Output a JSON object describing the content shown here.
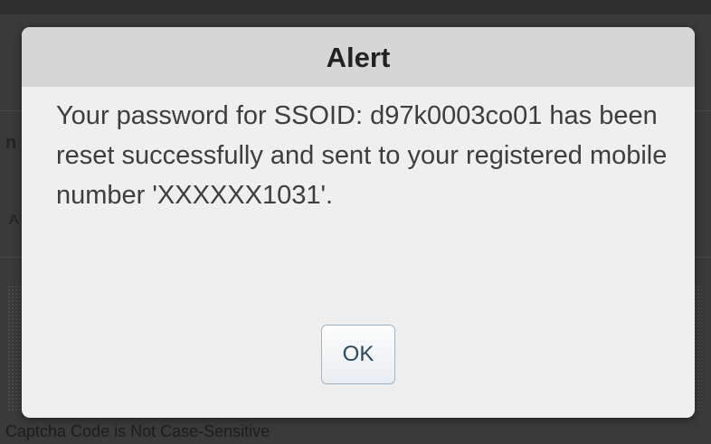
{
  "dialog": {
    "title": "Alert",
    "message": "Your password for SSOID: d97k0003co01 has been reset successfully and sent to your registered mobile number 'XXXXXX1031'.",
    "ok_label": "OK"
  },
  "background": {
    "captcha_note": "Captcha Code is Not Case-Sensitive"
  },
  "colors": {
    "overlay": "#3a3a3a",
    "dialog_bg": "#efefef",
    "header_bg": "#d6d6d6",
    "button_text": "#2a4a63"
  }
}
